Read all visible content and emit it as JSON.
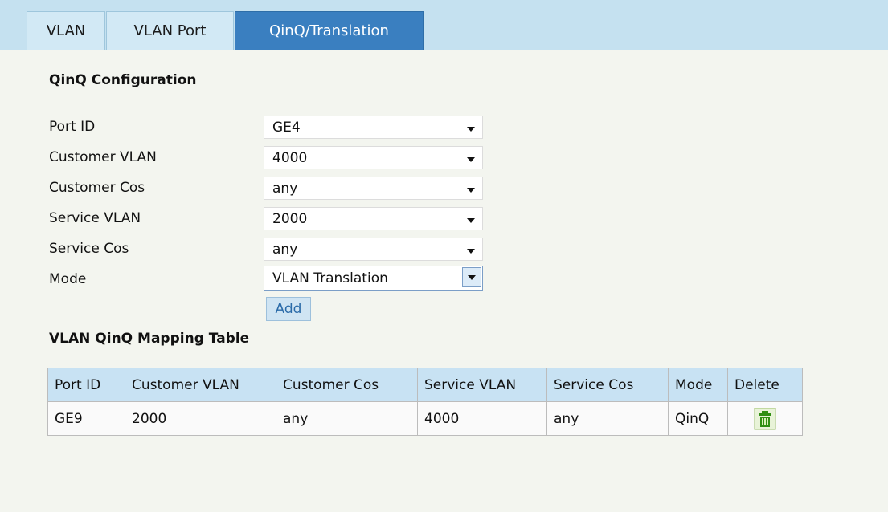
{
  "tabs": [
    {
      "label": "VLAN"
    },
    {
      "label": "VLAN Port"
    },
    {
      "label": "QinQ/Translation"
    }
  ],
  "qinq_config": {
    "title": "QinQ Configuration",
    "fields": [
      {
        "label": "Port ID",
        "value": "GE4"
      },
      {
        "label": "Customer VLAN",
        "value": "4000"
      },
      {
        "label": "Customer Cos",
        "value": "any"
      },
      {
        "label": "Service VLAN",
        "value": "2000"
      },
      {
        "label": "Service Cos",
        "value": "any"
      },
      {
        "label": "Mode",
        "value": "VLAN Translation"
      }
    ],
    "add_label": "Add"
  },
  "mapping_table": {
    "title": "VLAN QinQ Mapping Table",
    "headers": [
      "Port ID",
      "Customer VLAN",
      "Customer Cos",
      "Service VLAN",
      "Service Cos",
      "Mode",
      "Delete"
    ],
    "rows": [
      {
        "port_id": "GE9",
        "customer_vlan": "2000",
        "customer_cos": "any",
        "service_vlan": "4000",
        "service_cos": "any",
        "mode": "QinQ",
        "delete_icon": "trash-icon"
      }
    ]
  },
  "colors": {
    "tab_active": "#3a7fc0",
    "tab_bar": "#c5e1f0",
    "table_header": "#c8e2f3",
    "page_bg": "#f3f5ef",
    "delete_icon": "#2f8f12"
  }
}
